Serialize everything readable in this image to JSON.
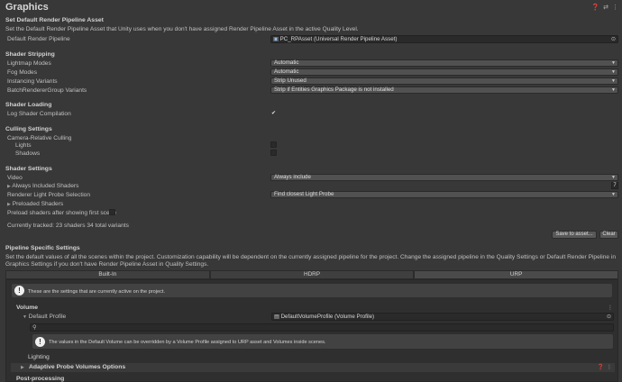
{
  "window": {
    "title": "Graphics"
  },
  "header_icons": [
    "help-icon",
    "settings-icon",
    "more-icon"
  ],
  "default_rp": {
    "heading": "Set Default Render Pipeline Asset",
    "description": "Set the Default Render Pipeline Asset that Unity uses when you don't have assigned Render Pipeline Asset in the active Quality Level.",
    "field_label": "Default Render Pipeline",
    "field_value": "PC_RPAsset (Universal Render Pipeline Asset)"
  },
  "shader_stripping": {
    "heading": "Shader Stripping",
    "rows": [
      {
        "label": "Lightmap Modes",
        "value": "Automatic"
      },
      {
        "label": "Fog Modes",
        "value": "Automatic"
      },
      {
        "label": "Instancing Variants",
        "value": "Strip Unused"
      },
      {
        "label": "BatchRendererGroup Variants",
        "value": "Strip if Entities Graphics Package is not installed"
      }
    ]
  },
  "shader_loading": {
    "heading": "Shader Loading",
    "log_label": "Log Shader Compilation",
    "log_checked": true
  },
  "culling": {
    "heading": "Culling Settings",
    "camera_relative": "Camera-Relative Culling",
    "lights": "Lights",
    "shadows": "Shadows"
  },
  "shader_settings": {
    "heading": "Shader Settings",
    "video_label": "Video",
    "video_value": "Always include",
    "always_included": "Always Included Shaders",
    "always_included_count": "7",
    "light_probe_label": "Renderer Light Probe Selection",
    "light_probe_value": "Find closest Light Probe",
    "preloaded": "Preloaded Shaders",
    "preload_after": "Preload shaders after showing first scene",
    "tracked": "Currently tracked: 23 shaders 34 total variants",
    "save_button": "Save to asset...",
    "clear_button": "Clear"
  },
  "pipeline": {
    "heading": "Pipeline Specific Settings",
    "description": "Set the default values of all the scenes within the project. Customization capability will be dependent on the currently assigned pipeline for the project. Change the assigned pipeline in the Quality Settings or Default Render Pipeline in Graphics Settings if you don't have Render Pipeline Asset in Quality Settings.",
    "tabs": [
      "Built-In",
      "HDRP",
      "URP"
    ],
    "active_tab": "URP",
    "active_notice": "These are the settings that are currently active on the project.",
    "volume_heading": "Volume",
    "default_profile_label": "Default Profile",
    "default_profile_value": "DefaultVolumeProfile (Volume Profile)",
    "volume_notice": "The values in the Default Volume can be overridden by a Volume Profile assigned to URP asset and Volumes inside scenes.",
    "lighting_heading": "Lighting",
    "apv": "Adaptive Probe Volumes Options",
    "post_processing": "Post-processing"
  }
}
